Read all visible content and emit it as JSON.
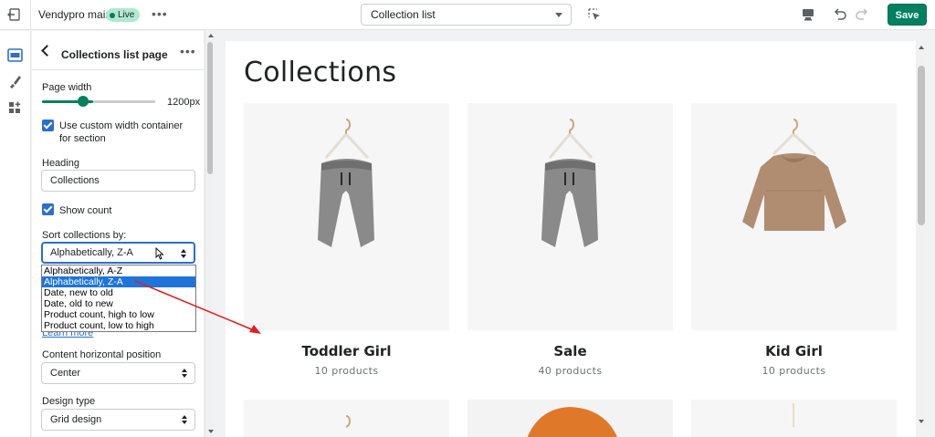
{
  "topbar": {
    "theme_name": "Vendypro main",
    "live_badge": "Live",
    "more": "•••",
    "page_select": "Collection list",
    "save_label": "Save"
  },
  "panel": {
    "title": "Collections list page",
    "more": "•••",
    "page_width_label": "Page width",
    "page_width_value": "1200px",
    "custom_width_label": "Use custom width container for section",
    "heading_label": "Heading",
    "heading_value": "Collections",
    "show_count_label": "Show count",
    "sort_label": "Sort collections by:",
    "sort_value": "Alphabetically, Z-A",
    "sort_options": [
      "Alphabetically, A-Z",
      "Alphabetically, Z-A",
      "Date, new to old",
      "Date, old to new",
      "Product count, high to low",
      "Product count, low to high"
    ],
    "learn_more": "Learn more",
    "content_pos_label": "Content horizontal position",
    "content_pos_value": "Center",
    "design_type_label": "Design type",
    "design_type_value": "Grid design"
  },
  "preview": {
    "heading": "Collections",
    "collections": [
      {
        "name": "Toddler Girl",
        "count": "10 products"
      },
      {
        "name": "Sale",
        "count": "40 products"
      },
      {
        "name": "Kid Girl",
        "count": "10 products"
      }
    ]
  },
  "colors": {
    "accent": "#008060",
    "selection": "#1e74d9",
    "annotation_arrow": "#e02020"
  }
}
